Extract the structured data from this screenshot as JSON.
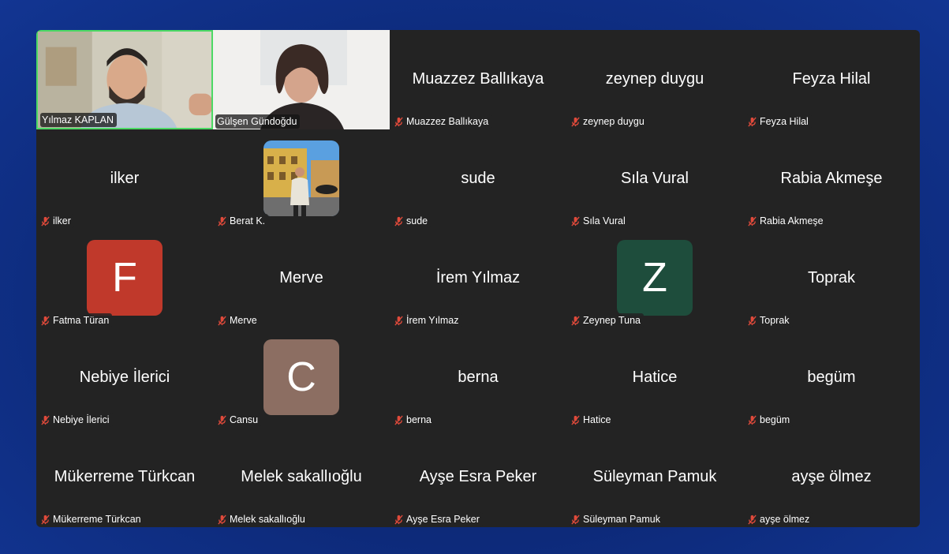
{
  "colors": {
    "background": "#0d2a7a",
    "grid_bg": "#232323",
    "active_border": "#4cd964",
    "mute_icon": "#e04a3b",
    "avatar_f": "#c0392b",
    "avatar_z": "#1e4d3c",
    "avatar_c": "#8c6e62"
  },
  "tiles": [
    {
      "label": "Yılmaz KAPLAN",
      "kind": "video",
      "active": true
    },
    {
      "label": "Gülşen Gündoğdu",
      "kind": "video"
    },
    {
      "label": "Muazzez Ballıkaya",
      "name": "Muazzez Ballıkaya",
      "muted": true
    },
    {
      "label": "zeynep duygu",
      "name": "zeynep duygu",
      "muted": true
    },
    {
      "label": "Feyza Hilal",
      "name": "Feyza Hilal",
      "muted": true
    },
    {
      "label": "ilker",
      "name": "ilker",
      "muted": true
    },
    {
      "label": "Berat K.",
      "kind": "photo",
      "muted": true
    },
    {
      "label": "sude",
      "name": "sude",
      "muted": true
    },
    {
      "label": "Sıla Vural",
      "name": "Sıla Vural",
      "muted": true
    },
    {
      "label": "Rabia Akmeşe",
      "name": "Rabia Akmeşe",
      "muted": true
    },
    {
      "label": "Fatma Türan",
      "initial": "F",
      "muted": true
    },
    {
      "label": "Merve",
      "name": "Merve",
      "muted": true
    },
    {
      "label": "İrem Yılmaz",
      "name": "İrem Yılmaz",
      "muted": true
    },
    {
      "label": "Zeynep Tuna",
      "initial": "Z",
      "muted": true
    },
    {
      "label": "Toprak",
      "name": "Toprak",
      "muted": true
    },
    {
      "label": "Nebiye İlerici",
      "name": "Nebiye İlerici",
      "muted": true
    },
    {
      "label": "Cansu",
      "initial": "C",
      "muted": true
    },
    {
      "label": "berna",
      "name": "berna",
      "muted": true
    },
    {
      "label": "Hatice",
      "name": "Hatice",
      "muted": true
    },
    {
      "label": "begüm",
      "name": "begüm",
      "muted": true
    },
    {
      "label": "Mükerreme Türkcan",
      "name": "Mükerreme Türkcan",
      "muted": true
    },
    {
      "label": "Melek sakallıoğlu",
      "name": "Melek sakallıoğlu",
      "muted": true
    },
    {
      "label": "Ayşe Esra Peker",
      "name": "Ayşe Esra Peker",
      "muted": true
    },
    {
      "label": "Süleyman Pamuk",
      "name": "Süleyman Pamuk",
      "muted": true
    },
    {
      "label": "ayşe ölmez",
      "name": "ayşe ölmez",
      "muted": true
    }
  ]
}
